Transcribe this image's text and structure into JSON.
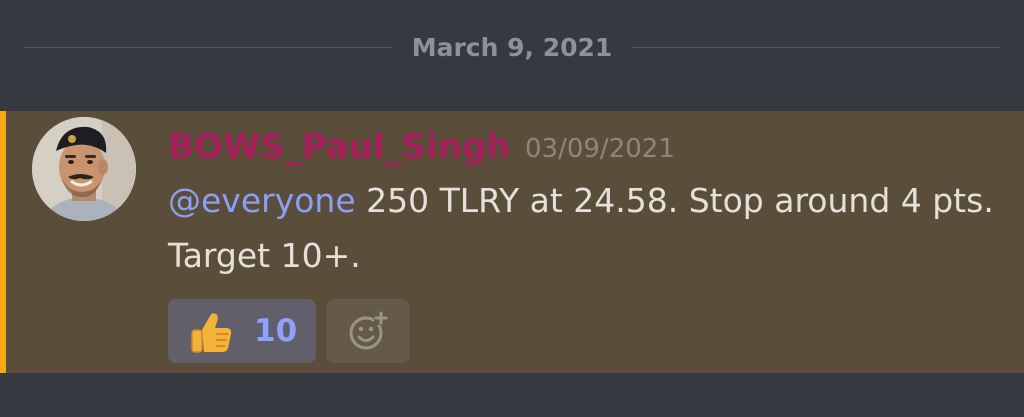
{
  "divider": {
    "date": "March 9, 2021"
  },
  "message": {
    "author": "BOWS_Paul_Singh",
    "timestamp": "03/09/2021",
    "mention": "@everyone",
    "text": " 250 TLRY at 24.58. Stop around 4 pts. Target 10+.",
    "reactions": [
      {
        "emoji": "thumbs-up-icon",
        "count": "10"
      }
    ],
    "add_reaction_icon": "add-reaction-icon"
  },
  "colors": {
    "background": "#36393f",
    "highlight": "#5a4e3a",
    "accent": "#faa81a",
    "username": "#a51e5b",
    "mention": "#8d9ef5",
    "reaction_count": "#8ea1ff"
  }
}
